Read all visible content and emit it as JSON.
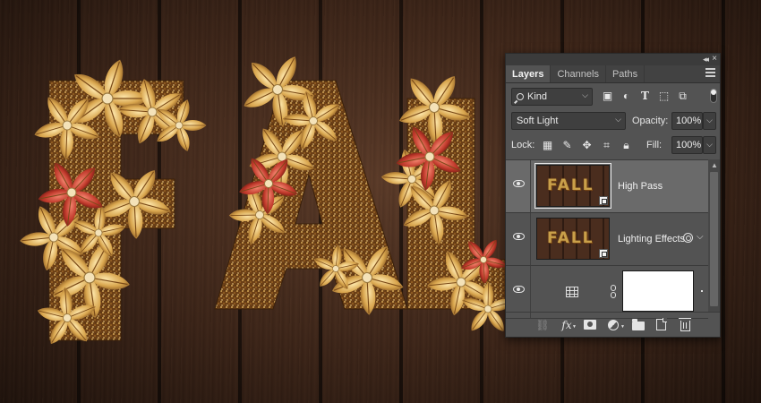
{
  "canvas": {
    "artwork_letters": [
      "F",
      "A",
      "L"
    ],
    "colors": {
      "wood_dark": "#2b1a12",
      "wood_mid": "#4a2d1e",
      "gold": "#d9b15a",
      "glitter": "#8a5a22",
      "red_leaf": "#c0392b"
    }
  },
  "panel": {
    "tabs": [
      {
        "label": "Layers",
        "active": true
      },
      {
        "label": "Channels",
        "active": false
      },
      {
        "label": "Paths",
        "active": false
      }
    ],
    "filter": {
      "kind_label": "Kind",
      "icons": [
        "image-filter-icon",
        "adjustment-filter-icon",
        "type-filter-icon",
        "shape-filter-icon",
        "smart-object-filter-icon"
      ]
    },
    "blend_mode": "Soft Light",
    "opacity_label": "Opacity:",
    "opacity_value": "100%",
    "lock_label": "Lock:",
    "fill_label": "Fill:",
    "fill_value": "100%",
    "layers": [
      {
        "name": "High Pass",
        "thumb_text": "FALL",
        "selected": true,
        "visible": true
      },
      {
        "name": "Lighting Effects",
        "thumb_text": "FALL",
        "selected": false,
        "visible": true
      },
      {
        "name": "",
        "selected": false,
        "visible": true,
        "has_mask": true
      }
    ],
    "bottom_icons": [
      "link-layers-icon",
      "fx-icon",
      "add-mask-icon",
      "adjustment-layer-icon",
      "new-group-icon",
      "new-layer-icon",
      "delete-layer-icon"
    ],
    "bottom_fx_label": "fx"
  }
}
